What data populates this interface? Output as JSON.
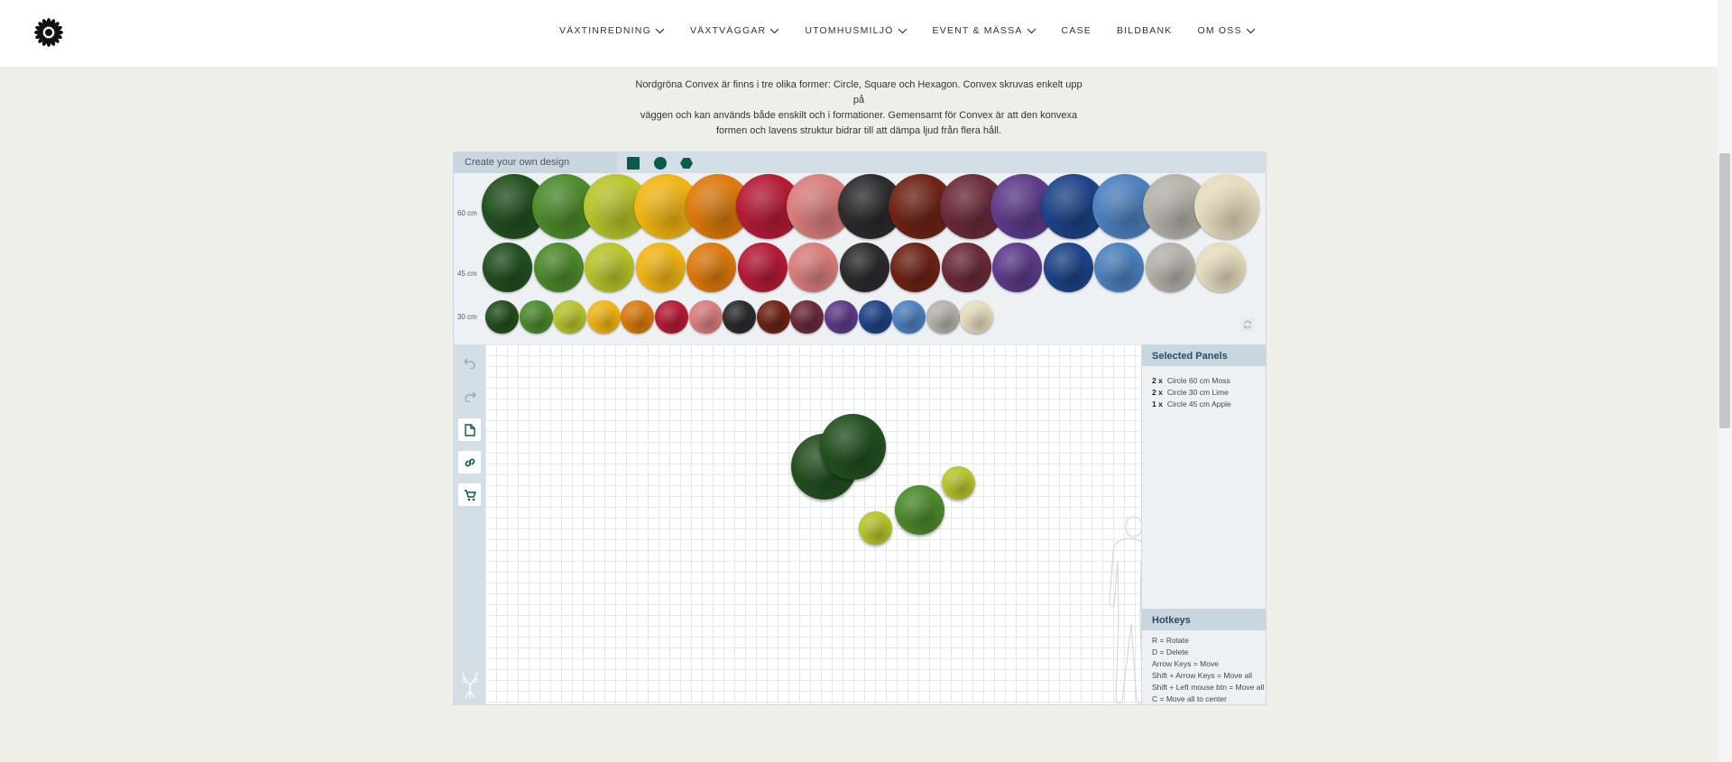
{
  "nav": {
    "items": [
      {
        "label": "VÄXTINREDNING",
        "has_dropdown": true
      },
      {
        "label": "VÄXTVÄGGAR",
        "has_dropdown": true
      },
      {
        "label": "UTOMHUSMILJÖ",
        "has_dropdown": true
      },
      {
        "label": "EVENT & MÄSSA",
        "has_dropdown": true
      },
      {
        "label": "CASE",
        "has_dropdown": false
      },
      {
        "label": "BILDBANK",
        "has_dropdown": false
      },
      {
        "label": "OM OSS",
        "has_dropdown": true
      }
    ]
  },
  "page": {
    "intro_lines": [
      "Nordgröna Convex är finns i tre olika former: Circle, Square och Hexagon. Convex skruvas enkelt upp på",
      "väggen och kan används både enskilt och i formationer. Gemensamt för Convex är att den konvexa",
      "formen och lavens struktur bidrar till att dämpa ljud från flera håll."
    ]
  },
  "designer": {
    "title": "Create your own design",
    "shapes": [
      "square",
      "circle",
      "hexagon"
    ],
    "selected_shape": "circle",
    "sizes": [
      "60 cm",
      "45 cm",
      "30 cm"
    ],
    "colors": [
      {
        "hex": "#234f1f"
      },
      {
        "hex": "#4d8a2c"
      },
      {
        "hex": "#b7c42b"
      },
      {
        "hex": "#f0b514"
      },
      {
        "hex": "#dc7a0c"
      },
      {
        "hex": "#b51b36"
      },
      {
        "hex": "#d97d7c"
      },
      {
        "hex": "#2b2b2d"
      },
      {
        "hex": "#6e2315"
      },
      {
        "hex": "#6b2a3a"
      },
      {
        "hex": "#5d3b8a"
      },
      {
        "hex": "#1e4388"
      },
      {
        "hex": "#4d80be"
      },
      {
        "hex": "#b5b2aa"
      },
      {
        "hex": "#e5dcbd"
      }
    ],
    "selected_panels_title": "Selected Panels",
    "selected_panels": [
      {
        "count": "2 x",
        "name": "Circle 60 cm Moss"
      },
      {
        "count": "2 x",
        "name": "Circle 30 cm Lime"
      },
      {
        "count": "1 x",
        "name": "Circle 45 cm Apple"
      }
    ],
    "hotkeys_title": "Hotkeys",
    "hotkeys": [
      "R = Rotate",
      "D = Delete",
      "Arrow Keys = Move",
      "Shift + Arrow Keys = Move all",
      "Shift + Left mouse btn = Move all",
      "C = Move all to center"
    ],
    "placed_panels": [
      {
        "size": "60 cm",
        "color": "#234f1f"
      },
      {
        "size": "60 cm",
        "color": "#234f1f"
      },
      {
        "size": "30 cm",
        "color": "#b7c42b"
      },
      {
        "size": "30 cm",
        "color": "#b7c42b"
      },
      {
        "size": "45 cm",
        "color": "#4d8a2c"
      }
    ]
  }
}
